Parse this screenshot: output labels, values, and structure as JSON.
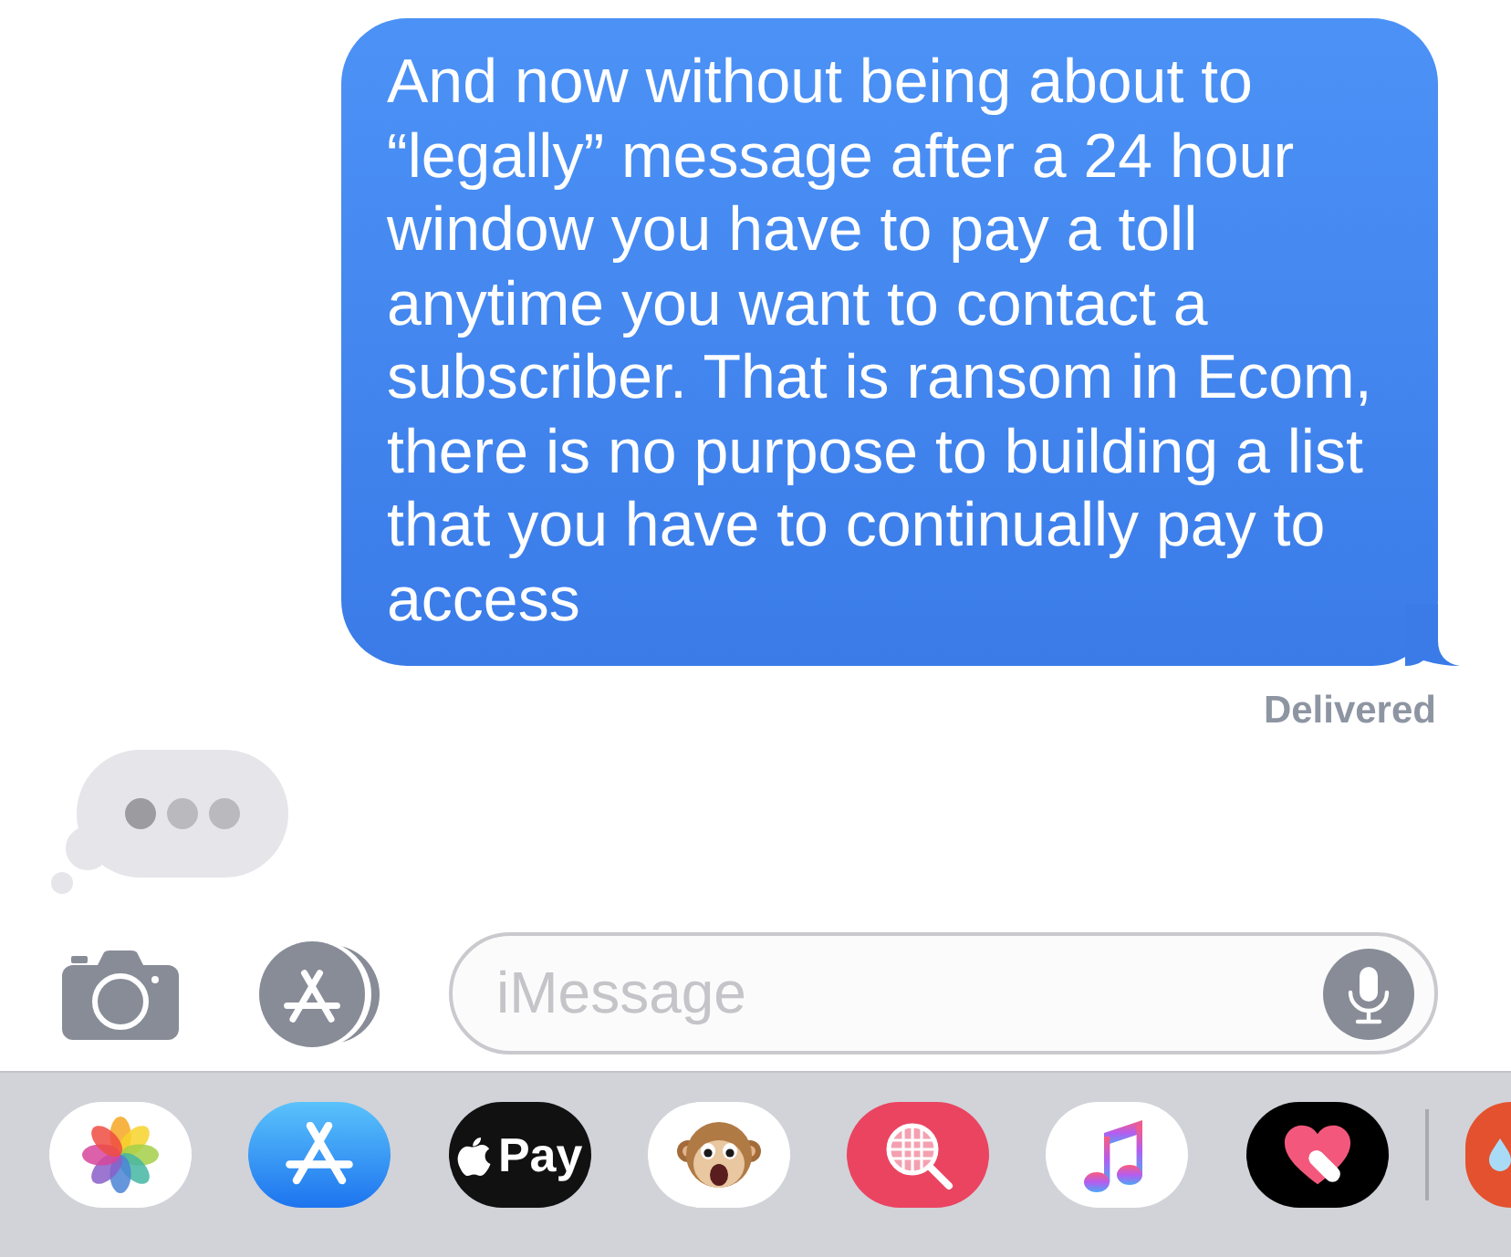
{
  "messages": [
    {
      "kind": "sent",
      "text": "And now without being about to “legally” message after a 24 hour window you have to pay a toll anytime you want to contact a subscriber. That is ransom in Ecom, there is no purpose to building a list that you have to continually pay to access",
      "status": "Delivered"
    }
  ],
  "typing_indicator": true,
  "compose": {
    "placeholder": "iMessage"
  },
  "app_drawer": [
    {
      "kind": "photos"
    },
    {
      "kind": "app_store"
    },
    {
      "kind": "apple_pay",
      "label": "Pay"
    },
    {
      "kind": "monkey"
    },
    {
      "kind": "globe_search"
    },
    {
      "kind": "music"
    },
    {
      "kind": "heart"
    },
    {
      "kind": "divider"
    },
    {
      "kind": "sticker"
    }
  ]
}
